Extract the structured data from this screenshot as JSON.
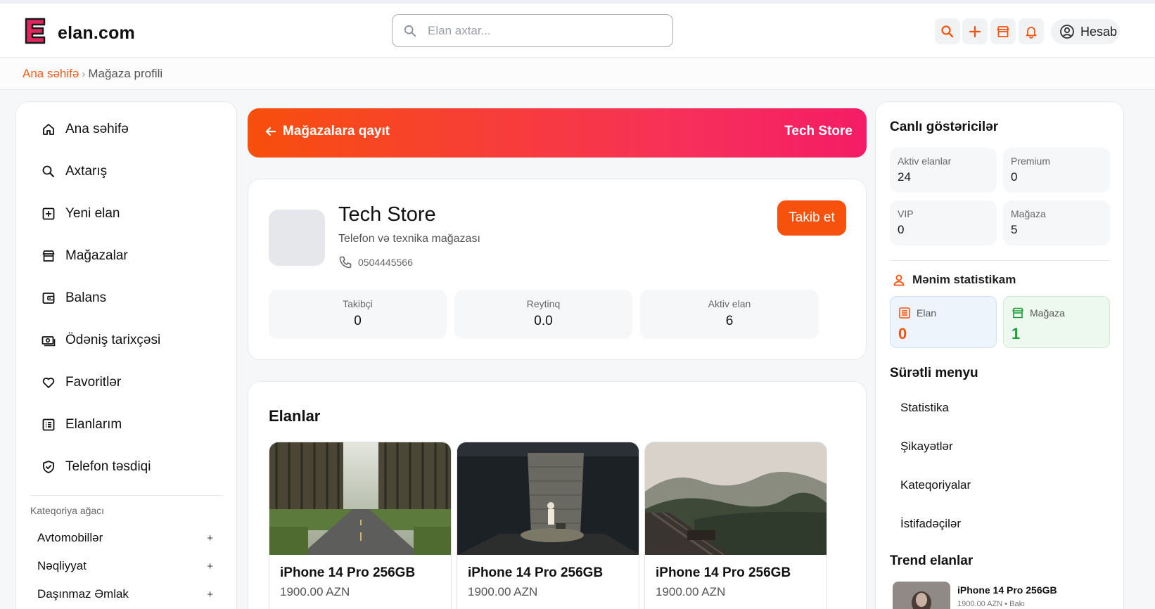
{
  "header": {
    "logo_text": "elan.com",
    "search_placeholder": "Elan axtar...",
    "account_label": "Hesab"
  },
  "breadcrumb": {
    "home": "Ana səhifə",
    "separator": "›",
    "current": "Mağaza profili"
  },
  "sidebar": {
    "items": [
      {
        "label": "Ana səhifə",
        "icon": "home-icon"
      },
      {
        "label": "Axtarış",
        "icon": "search-icon"
      },
      {
        "label": "Yeni elan",
        "icon": "plus-square-icon"
      },
      {
        "label": "Mağazalar",
        "icon": "store-icon"
      },
      {
        "label": "Balans",
        "icon": "wallet-icon"
      },
      {
        "label": "Ödəniş tarixçəsi",
        "icon": "cash-icon"
      },
      {
        "label": "Favoritlər",
        "icon": "heart-icon"
      },
      {
        "label": "Elanlarım",
        "icon": "list-icon"
      },
      {
        "label": "Telefon təsdiqi",
        "icon": "shield-check-icon"
      }
    ],
    "category_title": "Kateqoriya ağacı",
    "categories": [
      {
        "label": "Avtomobillər",
        "expand": "+"
      },
      {
        "label": "Nəqliyyat",
        "expand": "+"
      },
      {
        "label": "Daşınmaz Əmlak",
        "expand": "+"
      }
    ]
  },
  "banner": {
    "back_label": "Mağazalara qayıt",
    "store_name": "Tech Store"
  },
  "profile": {
    "name": "Tech Store",
    "description": "Telefon və texnika mağazası",
    "phone": "0504445566",
    "follow_label": "Takib et",
    "stats": [
      {
        "label": "Takibçi",
        "value": "0"
      },
      {
        "label": "Reytinq",
        "value": "0.0"
      },
      {
        "label": "Aktiv elan",
        "value": "6"
      }
    ]
  },
  "listings": {
    "title": "Elanlar",
    "items": [
      {
        "title": "iPhone 14 Pro 256GB",
        "price": "1900.00 AZN",
        "image": "forest-road-photo"
      },
      {
        "title": "iPhone 14 Pro 256GB",
        "price": "1900.00 AZN",
        "image": "child-by-wall-photo"
      },
      {
        "title": "iPhone 14 Pro 256GB",
        "price": "1900.00 AZN",
        "image": "misty-hills-photo"
      }
    ]
  },
  "live": {
    "title": "Canlı göstəricilər",
    "items": [
      {
        "label": "Aktiv elanlar",
        "value": "24"
      },
      {
        "label": "Premium",
        "value": "0"
      },
      {
        "label": "VIP",
        "value": "0"
      },
      {
        "label": "Mağaza",
        "value": "5"
      }
    ]
  },
  "my_stats": {
    "title": "Mənim statistikam",
    "elan": {
      "label": "Elan",
      "value": "0"
    },
    "magaza": {
      "label": "Mağaza",
      "value": "1"
    }
  },
  "quick_menu": {
    "title": "Sürətli menyu",
    "items": [
      "Statistika",
      "Şikayətlər",
      "Kateqoriyalar",
      "İstifadəçilər"
    ]
  },
  "trending": {
    "title": "Trend elanlar",
    "item": {
      "title": "iPhone 14 Pro 256GB",
      "subtitle": "1900.00 AZN • Bakı"
    }
  },
  "colors": {
    "accent": "#f7520d",
    "accent_pink": "#f41c66",
    "green": "#1f9d3a"
  }
}
